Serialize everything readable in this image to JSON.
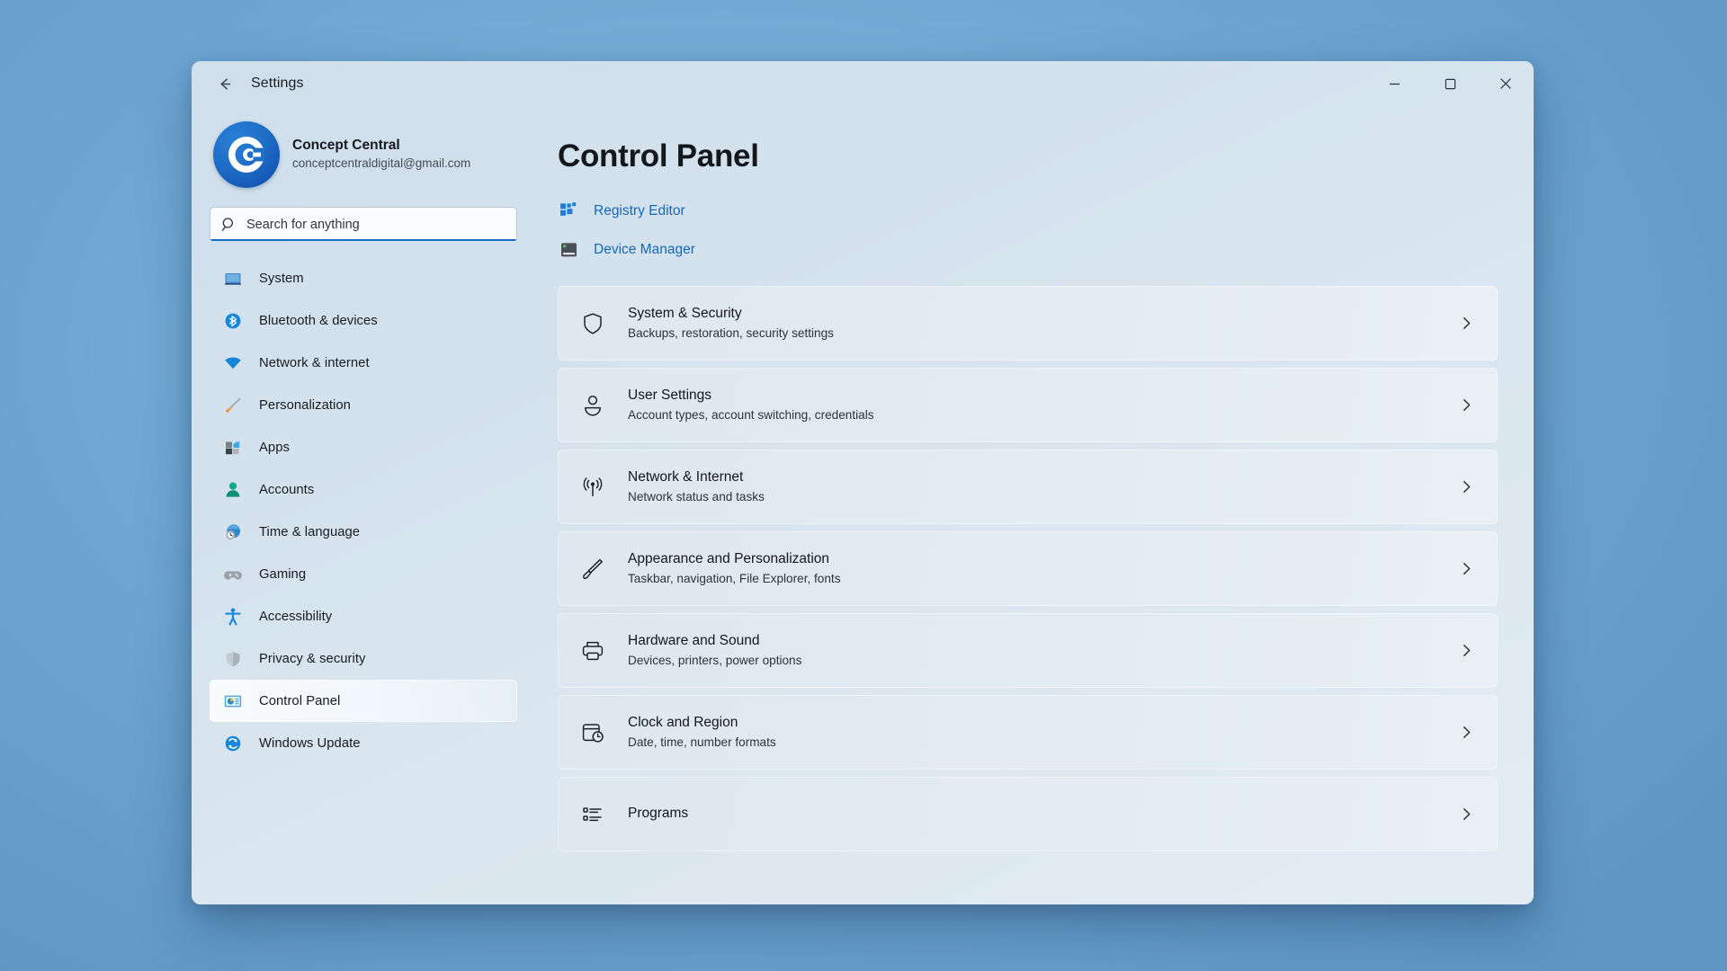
{
  "desktop": {
    "background_color": "#6ba4d1"
  },
  "window": {
    "title": "Settings",
    "back_icon": "back-arrow-icon",
    "controls": {
      "minimize": "minimize-icon",
      "maximize": "maximize-icon",
      "close": "close-icon"
    }
  },
  "sidebar": {
    "profile": {
      "name": "Concept Central",
      "email": "conceptcentraldigital@gmail.com",
      "avatar_icon": "concept-central-logo"
    },
    "search": {
      "placeholder": "Search for anything",
      "value": "",
      "icon": "search-icon"
    },
    "items": [
      {
        "label": "System",
        "icon": "monitor-icon",
        "selected": false
      },
      {
        "label": "Bluetooth & devices",
        "icon": "bluetooth-icon",
        "selected": false
      },
      {
        "label": "Network & internet",
        "icon": "wifi-icon",
        "selected": false
      },
      {
        "label": "Personalization",
        "icon": "paintbrush-icon",
        "selected": false
      },
      {
        "label": "Apps",
        "icon": "apps-icon",
        "selected": false
      },
      {
        "label": "Accounts",
        "icon": "account-person-icon",
        "selected": false
      },
      {
        "label": "Time & language",
        "icon": "clock-globe-icon",
        "selected": false
      },
      {
        "label": "Gaming",
        "icon": "gamepad-icon",
        "selected": false
      },
      {
        "label": "Accessibility",
        "icon": "accessibility-person-icon",
        "selected": false
      },
      {
        "label": "Privacy & security",
        "icon": "shield-icon",
        "selected": false
      },
      {
        "label": "Control Panel",
        "icon": "control-panel-icon",
        "selected": true
      },
      {
        "label": "Windows Update",
        "icon": "update-refresh-icon",
        "selected": false
      }
    ]
  },
  "main": {
    "page_title": "Control Panel",
    "accent_color": "#1568b8",
    "quick_links": [
      {
        "label": "Registry Editor",
        "icon": "registry-blocks-icon"
      },
      {
        "label": "Device Manager",
        "icon": "device-manager-icon"
      }
    ],
    "cards": [
      {
        "title": "System & Security",
        "subtitle": "Backups, restoration, security settings",
        "icon": "shield-outline-icon",
        "chevron": "chevron-right-icon"
      },
      {
        "title": "User Settings",
        "subtitle": "Account types, account switching, credentials",
        "icon": "person-outline-icon",
        "chevron": "chevron-right-icon"
      },
      {
        "title": "Network & Internet",
        "subtitle": "Network status and tasks",
        "icon": "broadcast-icon",
        "chevron": "chevron-right-icon"
      },
      {
        "title": "Appearance and Personalization",
        "subtitle": "Taskbar, navigation, File Explorer, fonts",
        "icon": "brush-outline-icon",
        "chevron": "chevron-right-icon"
      },
      {
        "title": "Hardware and Sound",
        "subtitle": "Devices, printers, power options",
        "icon": "printer-outline-icon",
        "chevron": "chevron-right-icon"
      },
      {
        "title": "Clock and Region",
        "subtitle": "Date, time, number formats",
        "icon": "calendar-clock-icon",
        "chevron": "chevron-right-icon"
      },
      {
        "title": "Programs",
        "subtitle": "",
        "icon": "list-bullet-icon",
        "chevron": "chevron-right-icon"
      }
    ]
  }
}
